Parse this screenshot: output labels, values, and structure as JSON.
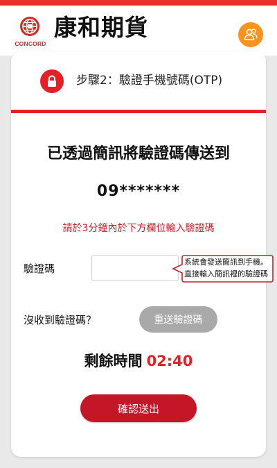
{
  "brand": {
    "name": "康和期貨",
    "sub": "CONCORD",
    "color": "#d42b25",
    "accent_bar": "#e8312a"
  },
  "header": {
    "user_icon": "user-group-icon",
    "user_icon_color": "#f7931e"
  },
  "step": {
    "icon": "lock-icon",
    "title": "步驟2：驗證手機號碼(OTP)"
  },
  "main": {
    "sent_title": "已透過簡訊將驗證碼傳送到",
    "phone_masked": "09*******",
    "hint": "請於3分鐘內於下方欄位輸入驗證碼"
  },
  "form": {
    "code_label": "驗證碼",
    "code_value": "",
    "tooltip_line1": "系統會發送簡訊到手機。",
    "tooltip_line2": "直接輸入簡訊裡的驗證碼"
  },
  "resend": {
    "label": "沒收到驗證碼？",
    "button": "重送驗證碼"
  },
  "timer": {
    "label": "剩餘時間",
    "value": "02:40"
  },
  "actions": {
    "confirm": "確認送出"
  }
}
